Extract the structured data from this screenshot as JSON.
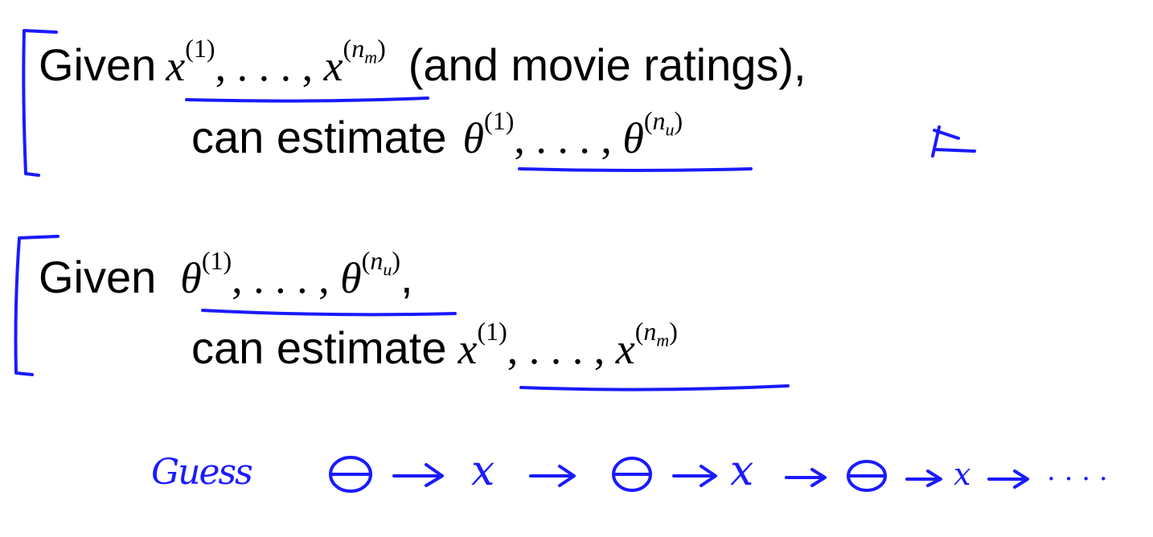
{
  "block1": {
    "line1": {
      "given": "Given",
      "x": "x",
      "sup_open": "(",
      "sup_one": "1",
      "sup_close": ")",
      "sep": ", . . . , ",
      "x2": "x",
      "n": "n",
      "sub": "m",
      "rest": "(and movie ratings),"
    },
    "line2": {
      "can": "can estimate",
      "theta": "θ",
      "sup_open": "(",
      "sup_one": "1",
      "sup_close": ")",
      "sep": ", . . . , ",
      "theta2": "θ",
      "n": "n",
      "sub": "u"
    }
  },
  "block2": {
    "line1": {
      "given": "Given",
      "theta": "θ",
      "sup_open": "(",
      "sup_one": "1",
      "sup_close": ")",
      "sep": ", . . . , ",
      "theta2": "θ",
      "n": "n",
      "sub": "u",
      "rest": ","
    },
    "line2": {
      "can": "can estimate",
      "x": "x",
      "sup_open": "(",
      "sup_one": "1",
      "sup_close": ")",
      "sep": ", . . . , ",
      "x2": "x",
      "n": "n",
      "sub": "m"
    }
  },
  "handwriting": {
    "guess": "Guess",
    "seq_x1": "x",
    "seq_x2": "x",
    "seq_x3": "x",
    "dots": ". . . ."
  },
  "colors": {
    "ink": "#1a1aff",
    "text": "#000000",
    "background": "#ffffff"
  }
}
